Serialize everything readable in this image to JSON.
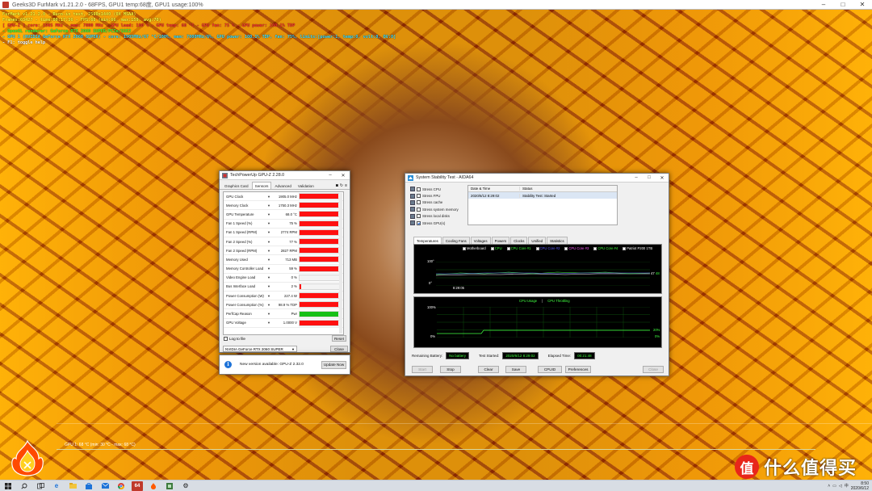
{
  "furmark": {
    "title": "Geeks3D FurMark v1.21.2.0 - 68FPS, GPU1 temp:68度, GPU1 usage:100%",
    "osd": [
      {
        "text": "FurMark v1.21.2.0 - Burn-in test, 2560x1440 (0X MSAA)",
        "color": "#ffff40"
      },
      {
        "text": "Frames:63427 - time:00:17:36 - FPS:68 (min:66, max:159, avg:70)",
        "color": "#ffff40"
      },
      {
        "text": "[ GPU-Z ] core: 1905 MHz - mem: 7000 MHz - GPU load: 100 % - GPU temp: 68 °C - GPU fan: 75 % - GPU power: 100.1% TDP",
        "color": "#ff3030"
      },
      {
        "text": "- OpenGL renderer: GeForce RTX 2060 SUPER/PCIe/SSE2",
        "color": "#40ff40"
      },
      {
        "text": "- GPU 1 (NVIDIA GeForce RTX 2060 SUPER) - core: 1905MHz/67 °C/100%, mem: 7000MHz/6%, GPU power: 100.1% TDP, fan: 75%, limits:[power:1, temp:0, volt:0, OV:0]",
        "color": "#40e0ff"
      },
      {
        "text": "- F1: toggle help",
        "color": "#ffffff"
      }
    ],
    "graph_label": "GPU 1: 68 °C (min: 30 °C - max: 68 °C)"
  },
  "watermark": {
    "glyph": "值",
    "text": "什么值得买"
  },
  "taskbar": {
    "icons": [
      "windows-icon",
      "search-icon",
      "task-view-icon",
      "edge-icon",
      "explorer-icon",
      "store-icon",
      "mail-icon",
      "chrome-icon",
      "aida64-icon",
      "furmark-icon",
      "gpuz-icon",
      "settings-icon"
    ],
    "aida_badge": "64",
    "time": "8:50",
    "date": "2020/6/12"
  },
  "gpuz": {
    "title": "TechPowerUp GPU-Z 2.28.0",
    "tabs": [
      "Graphics Card",
      "Sensors",
      "Advanced",
      "Validation"
    ],
    "active_tab": 1,
    "sensors": [
      {
        "label": "GPU Clock",
        "value": "1905.0 MHz",
        "fill": 0.96,
        "color": "#ff1010"
      },
      {
        "label": "Memory Clock",
        "value": "1750.3 MHz",
        "fill": 0.96,
        "color": "#ff1010"
      },
      {
        "label": "GPU Temperature",
        "value": "68.0 °C",
        "fill": 0.96,
        "color": "#ff1010"
      },
      {
        "label": "Fan 1 Speed (%)",
        "value": "75 %",
        "fill": 0.96,
        "color": "#ff1010"
      },
      {
        "label": "Fan 1 Speed (RPM)",
        "value": "2774 RPM",
        "fill": 0.96,
        "color": "#ff1010"
      },
      {
        "label": "Fan 2 Speed (%)",
        "value": "77 %",
        "fill": 0.96,
        "color": "#ff1010"
      },
      {
        "label": "Fan 2 Speed (RPM)",
        "value": "2827 RPM",
        "fill": 0.96,
        "color": "#ff1010"
      },
      {
        "label": "Memory Used",
        "value": "713 MB",
        "fill": 0.96,
        "color": "#ff1010"
      },
      {
        "label": "Memory Controller Load",
        "value": "59 %",
        "fill": 0.96,
        "color": "#ff1010"
      },
      {
        "label": "Video Engine Load",
        "value": "0 %",
        "fill": 0.0,
        "color": "#ff1010"
      },
      {
        "label": "Bus Interface Load",
        "value": "2 %",
        "fill": 0.04,
        "color": "#ff1010"
      },
      {
        "label": "Power Consumption (W)",
        "value": "227.4 W",
        "fill": 0.96,
        "color": "#ff1010"
      },
      {
        "label": "Power Consumption (%)",
        "value": "98.9 % TDP",
        "fill": 0.96,
        "color": "#ff1010"
      },
      {
        "label": "PerfCap Reason",
        "value": "Pwr",
        "fill": 0.96,
        "color": "#16c016"
      },
      {
        "label": "GPU Voltage",
        "value": "1.0000 V",
        "fill": 0.96,
        "color": "#ff1010"
      }
    ],
    "log_to_file": "Log to file",
    "reset": "Reset",
    "device": "NVIDIA GeForce RTX 2060 SUPER",
    "close": "Close"
  },
  "notify": {
    "message": "New version available: GPU-Z 2.32.0",
    "button": "Update Now"
  },
  "aida": {
    "title": "System Stability Test - AIDA64",
    "options": [
      {
        "label": "Stress CPU",
        "checked": false
      },
      {
        "label": "Stress FPU",
        "checked": false
      },
      {
        "label": "Stress cache",
        "checked": false
      },
      {
        "label": "Stress system memory",
        "checked": false
      },
      {
        "label": "Stress local disks",
        "checked": false
      },
      {
        "label": "Stress GPU(s)",
        "checked": true
      }
    ],
    "table": {
      "headers": [
        "Date & Time",
        "Status"
      ],
      "rows": [
        [
          "2020/6/12 8:29:02",
          "Stability Test: Started"
        ]
      ]
    },
    "tabs": [
      "Temperatures",
      "Cooling Fans",
      "Voltages",
      "Powers",
      "Clocks",
      "Unified",
      "Statistics"
    ],
    "active_tab": 0,
    "temp_legend": [
      {
        "label": "Motherboard",
        "color": "#ffffff"
      },
      {
        "label": "CPU",
        "color": "#40ff40"
      },
      {
        "label": "CPU Core #1",
        "color": "#40ff40"
      },
      {
        "label": "CPU Core #2",
        "color": "#6060ff"
      },
      {
        "label": "CPU Core #3",
        "color": "#ff60ff"
      },
      {
        "label": "CPU Core #4",
        "color": "#40ff40"
      },
      {
        "label": "Patriot P200 1TB",
        "color": "#ffffff"
      }
    ],
    "temp_axis": {
      "top": "100°",
      "bottom": "0°",
      "time": "8:29:05",
      "right_a": "47",
      "right_b": "48"
    },
    "usage_legend": {
      "cpu": "CPU Usage",
      "sep": "|",
      "throttling": "CPU Throttling"
    },
    "usage_axis": {
      "top": "100%",
      "bottom": "0%",
      "right_a": "20%",
      "right_b": "0%"
    },
    "status": {
      "battery_label": "Remaining Battery:",
      "battery_value": "No battery",
      "started_label": "Test Started:",
      "started_value": "2020/6/12 8:29:02",
      "elapsed_label": "Elapsed Time:",
      "elapsed_value": "00:21:48"
    },
    "buttons": {
      "start": "Start",
      "stop": "Stop",
      "clear": "Clear",
      "save": "Save",
      "cpuid": "CPUID",
      "preferences": "Preferences",
      "close": "Close"
    }
  }
}
